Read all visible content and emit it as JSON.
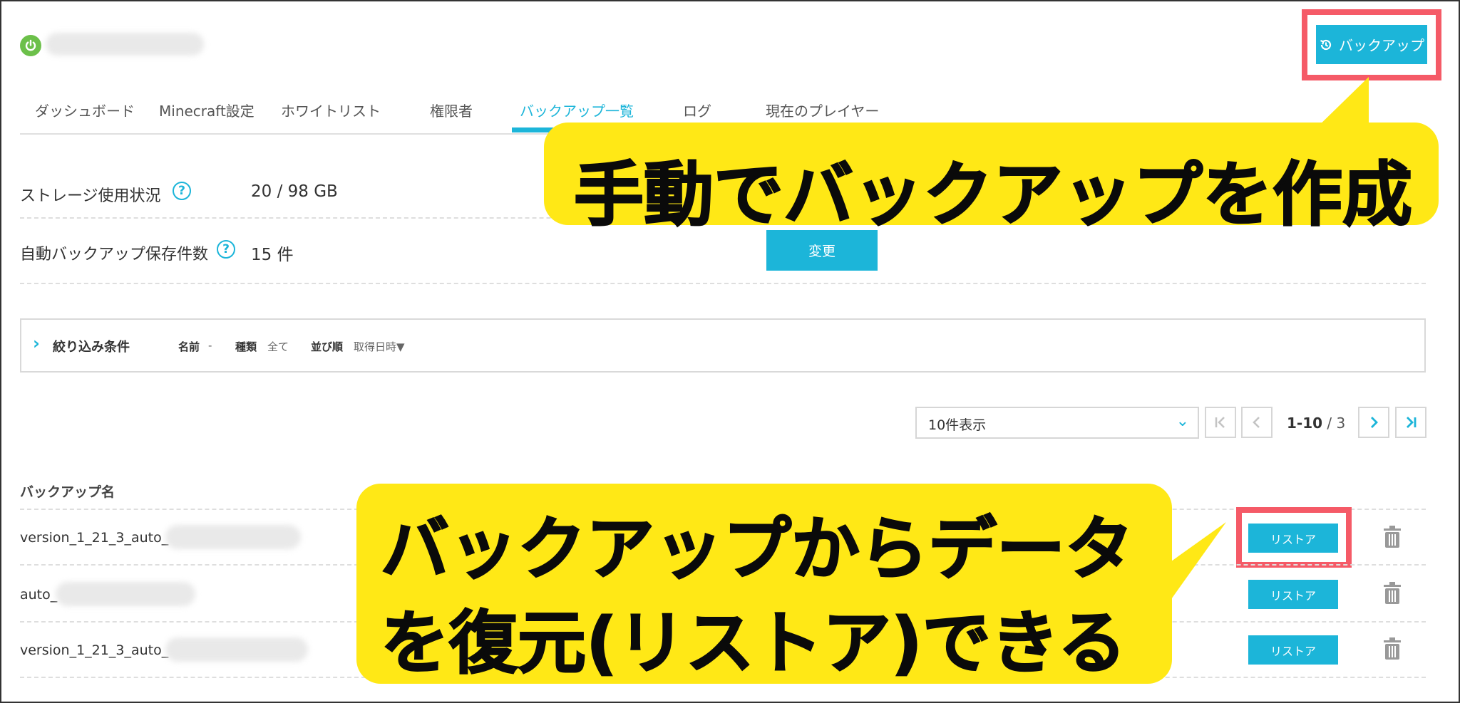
{
  "header": {
    "backup_button_label": "バックアップ",
    "icons": {
      "server": "power-icon",
      "backup": "history-icon"
    }
  },
  "tabs": [
    {
      "label": "ダッシュボード",
      "active": false
    },
    {
      "label": "Minecraft設定",
      "active": false
    },
    {
      "label": "ホワイトリスト",
      "active": false
    },
    {
      "label": "権限者",
      "active": false
    },
    {
      "label": "バックアップ一覧",
      "active": true
    },
    {
      "label": "ログ",
      "active": false
    },
    {
      "label": "現在のプレイヤー",
      "active": false
    }
  ],
  "storage": {
    "usage_label": "ストレージ使用状況",
    "usage_value": "20 / 98 GB",
    "auto_backup_label": "自動バックアップ保存件数",
    "auto_backup_value": "15 件",
    "change_button_label": "変更",
    "help_icon": "?"
  },
  "filter": {
    "title": "絞り込み条件",
    "name_label": "名前",
    "name_value": "-",
    "type_label": "種類",
    "type_value": "全て",
    "sort_label": "並び順",
    "sort_value": "取得日時▼"
  },
  "pagination": {
    "per_page": "10件表示",
    "range": "1-10",
    "total": "/ 3"
  },
  "table": {
    "column_header": "バックアップ名",
    "rows": [
      {
        "name": "version_1_21_3_auto_",
        "restore_label": "リストア"
      },
      {
        "name": "auto_",
        "restore_label": "リストア"
      },
      {
        "name": "version_1_21_3_auto_",
        "restore_label": "リストア"
      }
    ]
  },
  "annotations": {
    "top_callout": "手動でバックアップを作成",
    "bottom_callout_line1": "バックアップからデータ",
    "bottom_callout_line2": "を復元(リストア)できる"
  },
  "colors": {
    "accent": "#1cb5d9",
    "highlight_frame": "#f55a67",
    "callout_bg": "#ffe816",
    "server_status": "#6cc04a"
  }
}
